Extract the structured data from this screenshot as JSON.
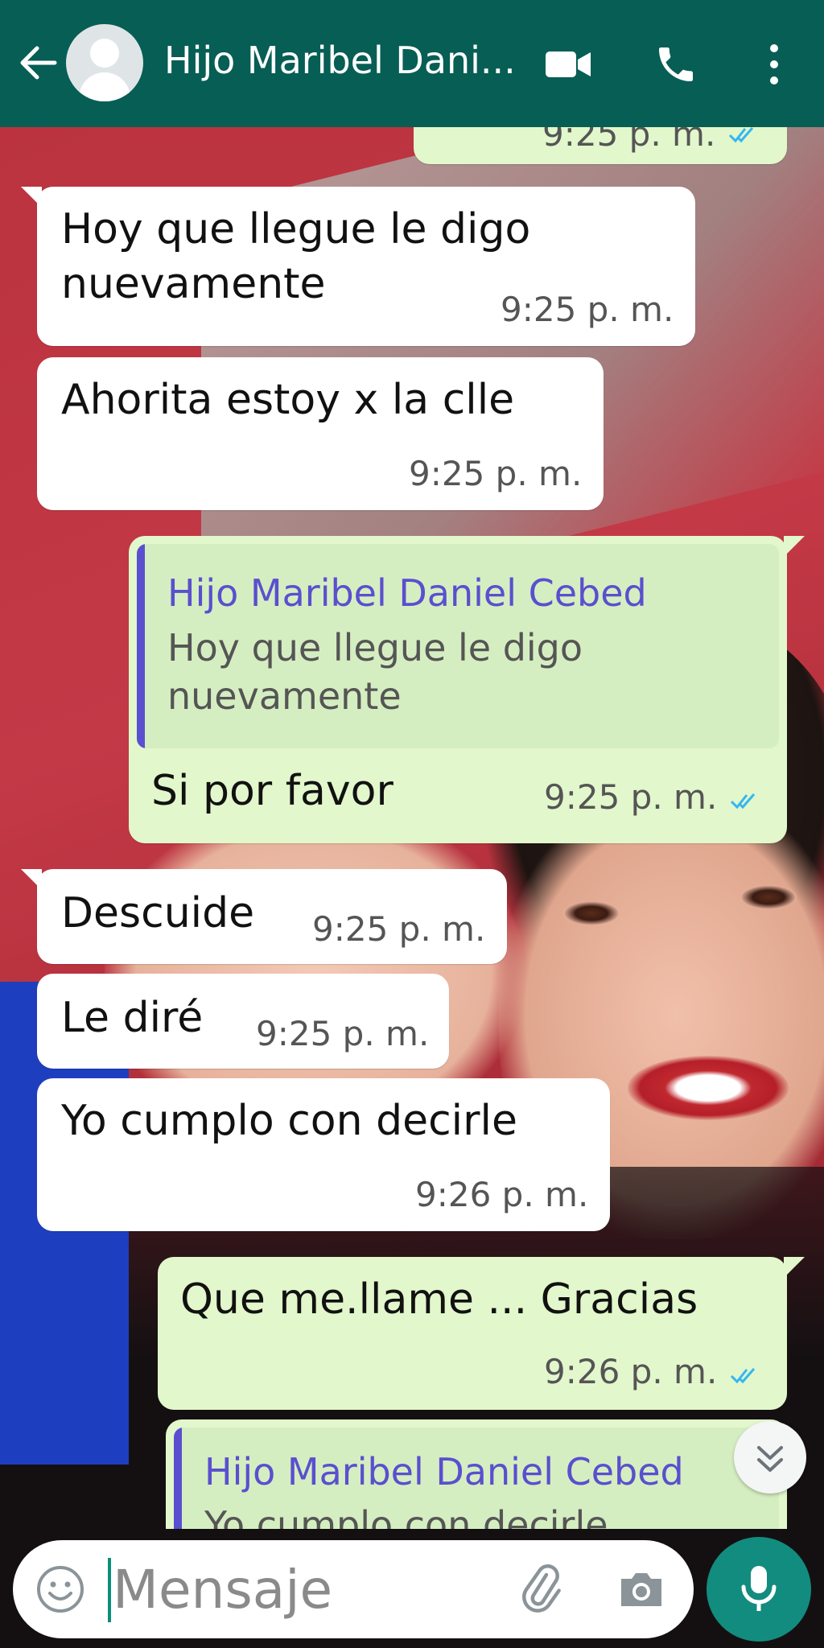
{
  "header": {
    "contact_name": "Hijo Maribel Dani...",
    "back_icon": "arrow-left-icon",
    "avatar_icon": "default-avatar-icon",
    "actions": [
      "video-call-icon",
      "voice-call-icon",
      "more-options-icon"
    ]
  },
  "messages": [
    {
      "direction": "out",
      "text": "",
      "time": "9:25 p. m.",
      "status": "read",
      "partial": true
    },
    {
      "direction": "in",
      "lines": [
        "Hoy que llegue le digo",
        "nuevamente"
      ],
      "time": "9:25 p. m."
    },
    {
      "direction": "in",
      "lines": [
        "Ahorita estoy x la clle"
      ],
      "time": "9:25 p. m."
    },
    {
      "direction": "out",
      "quote": {
        "name": "Hijo Maribel Daniel Cebed",
        "lines": [
          "Hoy que llegue le digo",
          "nuevamente"
        ]
      },
      "text": "Si por favor",
      "time": "9:25 p. m.",
      "status": "read"
    },
    {
      "direction": "in",
      "lines": [
        "Descuide"
      ],
      "time": "9:25 p. m."
    },
    {
      "direction": "in",
      "lines": [
        "Le diré"
      ],
      "time": "9:25 p. m."
    },
    {
      "direction": "in",
      "lines": [
        "Yo cumplo con decirle"
      ],
      "time": "9:26 p. m."
    },
    {
      "direction": "out",
      "text": "Que me.llame ... Gracias",
      "time": "9:26 p. m.",
      "status": "read"
    },
    {
      "direction": "out",
      "quote": {
        "name": "Hijo Maribel Daniel Cebed",
        "lines": [
          "Yo cumplo con decirle"
        ]
      },
      "partial": true
    }
  ],
  "composer": {
    "placeholder": "Mensaje",
    "emoji_icon": "emoji-icon",
    "attach_icon": "paperclip-icon",
    "camera_icon": "camera-icon",
    "mic_icon": "microphone-icon"
  },
  "colors": {
    "header": "#075e54",
    "outgoing_bubble": "#e2f7cb",
    "incoming_bubble": "#ffffff",
    "quote_accent": "#5a4fcf",
    "read_ticks": "#34b7f1",
    "mic_button": "#128c7e"
  }
}
